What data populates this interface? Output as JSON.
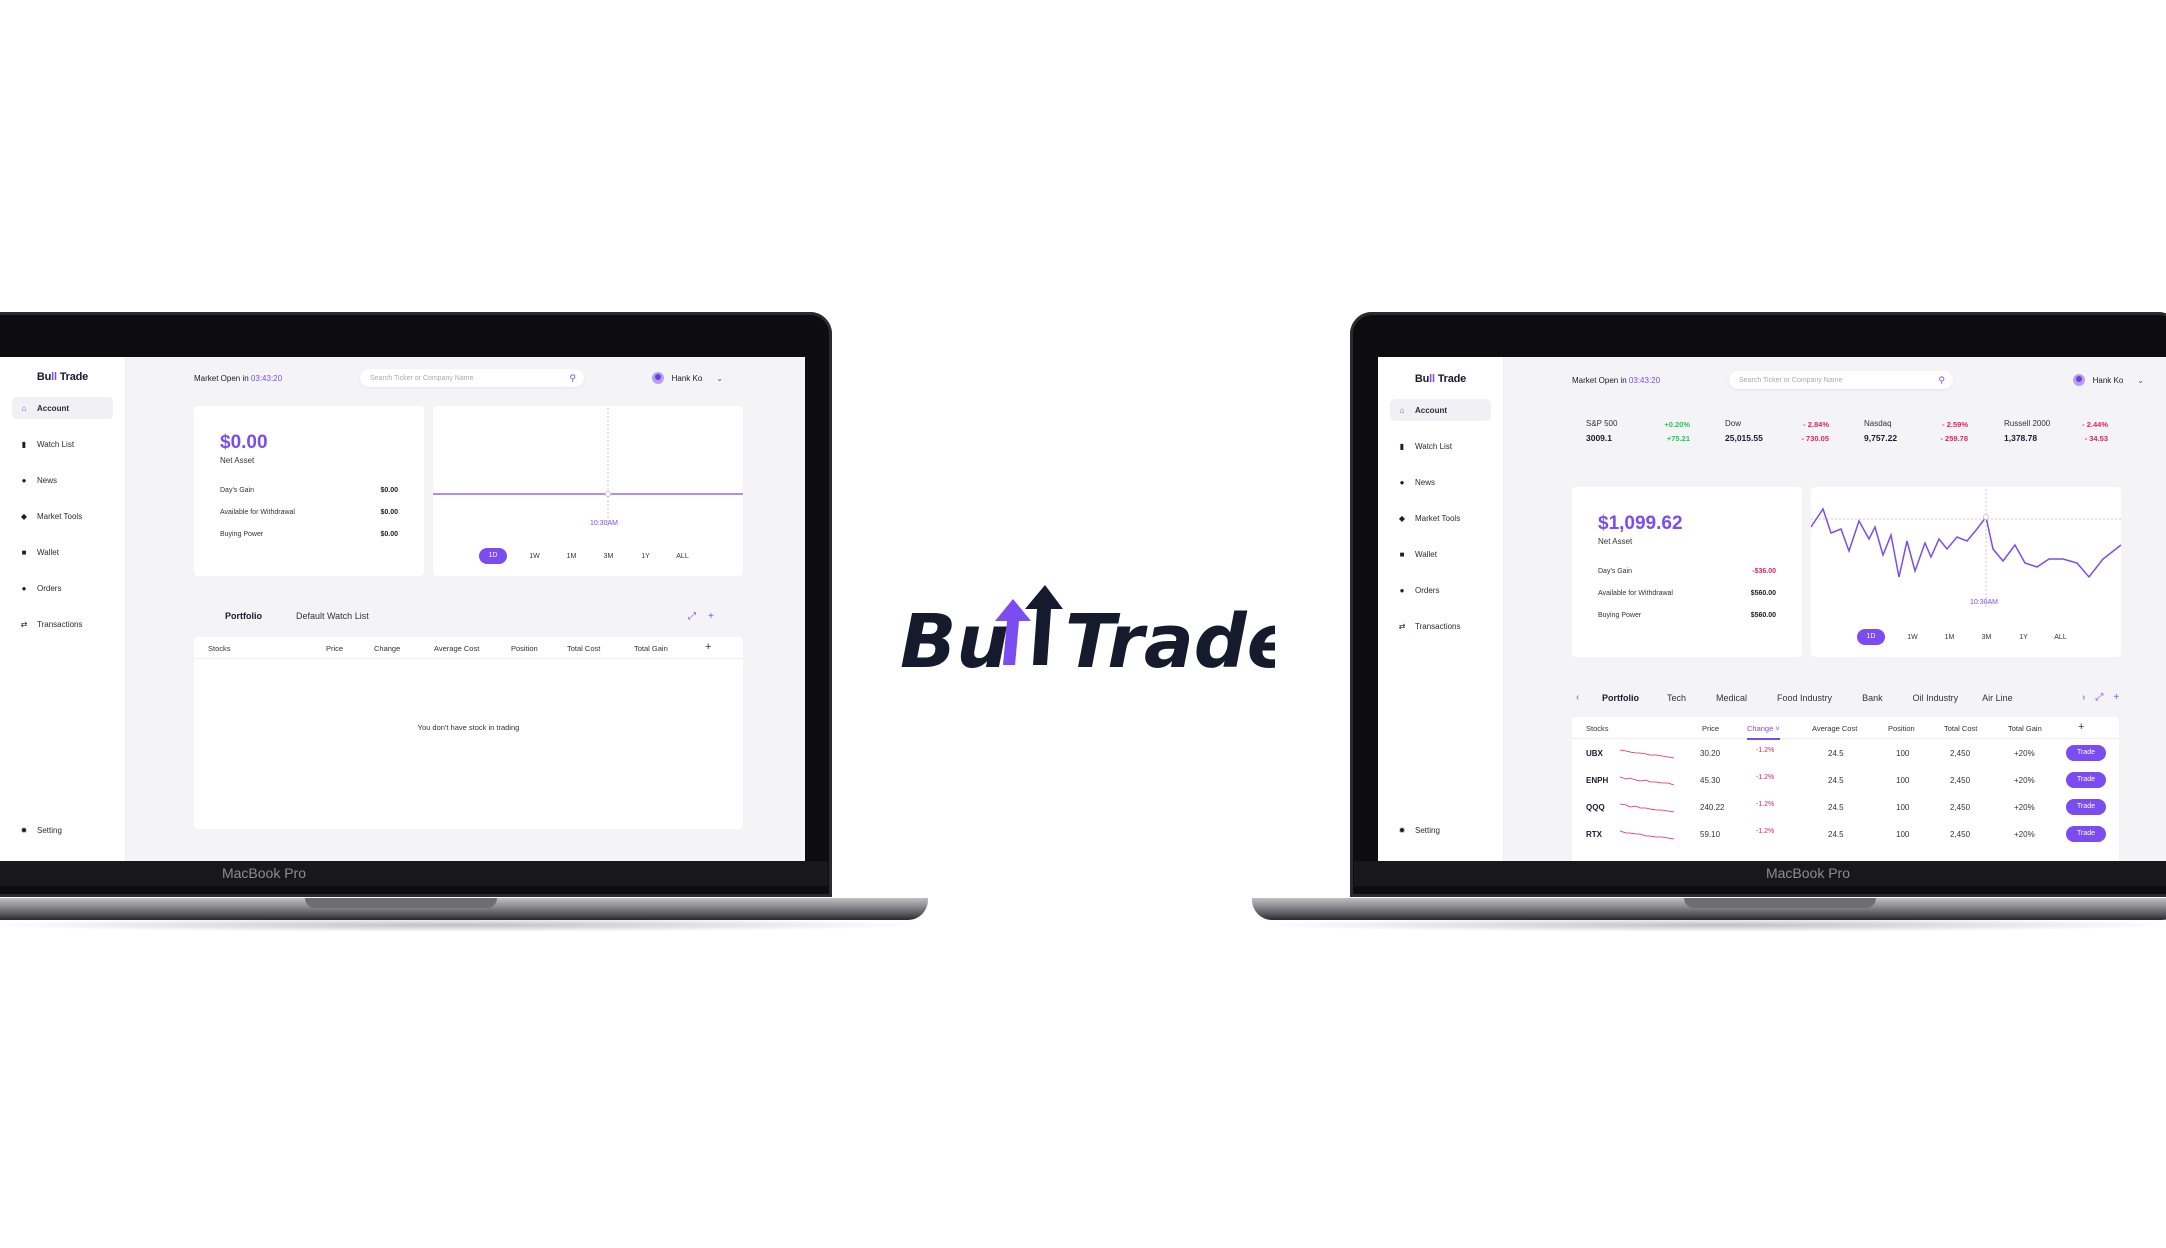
{
  "brand": {
    "name_part1": "Bu",
    "name_part2": "Trade",
    "small_logo_a": "Bu",
    "small_logo_b": "ll",
    "small_logo_c": " Trade"
  },
  "laptop_label": "MacBook Pro",
  "colors": {
    "accent": "#7b4cf0",
    "negative": "#e0245e",
    "positive": "#22c55e",
    "dark": "#151a2c"
  },
  "sidebar": {
    "items": [
      {
        "label": "Account",
        "icon": "home-icon"
      },
      {
        "label": "Watch List",
        "icon": "chart-icon"
      },
      {
        "label": "News",
        "icon": "news-icon"
      },
      {
        "label": "Market Tools",
        "icon": "tools-icon"
      },
      {
        "label": "Wallet",
        "icon": "wallet-icon"
      },
      {
        "label": "Orders",
        "icon": "orders-icon"
      },
      {
        "label": "Transactions",
        "icon": "transactions-icon"
      }
    ],
    "setting": "Setting"
  },
  "topbar": {
    "market_label": "Market Open in ",
    "market_time": "03:43:20",
    "search_placeholder": "Search Ticker or Company Name",
    "user_name": "Hank Ko"
  },
  "left_screen": {
    "net_asset_value": "$0.00",
    "net_asset_label": "Net Asset",
    "stats": [
      {
        "label": "Day's Gain",
        "value": "$0.00"
      },
      {
        "label": "Available for Withdrawal",
        "value": "$0.00"
      },
      {
        "label": "Buying Power",
        "value": "$0.00"
      }
    ],
    "chart_time_label": "10:30AM",
    "ranges": [
      "1D",
      "1W",
      "1M",
      "3M",
      "1Y",
      "ALL"
    ],
    "tabs": [
      "Portfolio",
      "Default Watch List"
    ],
    "columns": [
      "Stocks",
      "Price",
      "Change",
      "Average  Cost",
      "Position",
      "Total Cost",
      "Total Gain"
    ],
    "empty_message": "You don't have stock in trading"
  },
  "right_screen": {
    "indices": [
      {
        "name": "S&P 500",
        "value": "3009.1",
        "pct": "+0.20%",
        "chg": "+75.21",
        "dir": "up"
      },
      {
        "name": "Dow",
        "value": "25,015.55",
        "pct": "- 2.84%",
        "chg": "- 730.05",
        "dir": "down"
      },
      {
        "name": "Nasdaq",
        "value": "9,757.22",
        "pct": "- 2.59%",
        "chg": "- 259.78",
        "dir": "down"
      },
      {
        "name": "Russell 2000",
        "value": "1,378.78",
        "pct": "- 2.44%",
        "chg": "- 34.53",
        "dir": "down"
      }
    ],
    "net_asset_value": "$1,099.62",
    "net_asset_label": "Net Asset",
    "stats": [
      {
        "label": "Day's Gain",
        "value": "-$36.00",
        "neg": true
      },
      {
        "label": "Available for Withdrawal",
        "value": "$560.00",
        "neg": false
      },
      {
        "label": "Buying Power",
        "value": "$560.00",
        "neg": false
      }
    ],
    "chart_time_label": "10:30AM",
    "ranges": [
      "1D",
      "1W",
      "1M",
      "3M",
      "1Y",
      "ALL"
    ],
    "tabs": [
      "Portfolio",
      "Tech",
      "Medical",
      "Food Industry",
      "Bank",
      "Oil Industry",
      "Air Line"
    ],
    "columns": [
      "Stocks",
      "Price",
      "Change",
      "Average  Cost",
      "Position",
      "Total Cost",
      "Total Gain"
    ],
    "change_sort_arrow": "˅",
    "rows": [
      {
        "ticker": "UBX",
        "price": "30.20",
        "change": "-1.2%",
        "avg_cost": "24.5",
        "position": "100",
        "total_cost": "2,450",
        "total_gain": "+20%",
        "action": "Trade"
      },
      {
        "ticker": "ENPH",
        "price": "45.30",
        "change": "-1.2%",
        "avg_cost": "24.5",
        "position": "100",
        "total_cost": "2,450",
        "total_gain": "+20%",
        "action": "Trade"
      },
      {
        "ticker": "QQQ",
        "price": "240.22",
        "change": "-1.2%",
        "avg_cost": "24.5",
        "position": "100",
        "total_cost": "2,450",
        "total_gain": "+20%",
        "action": "Trade"
      },
      {
        "ticker": "RTX",
        "price": "59.10",
        "change": "-1.2%",
        "avg_cost": "24.5",
        "position": "100",
        "total_cost": "2,450",
        "total_gain": "+20%",
        "action": "Trade"
      }
    ]
  }
}
